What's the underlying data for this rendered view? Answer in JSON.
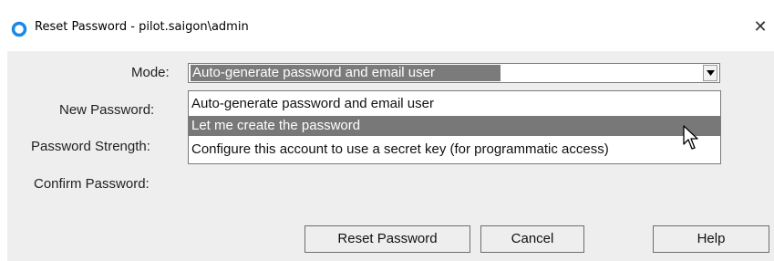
{
  "window": {
    "title": "Reset Password - pilot.saigon\\admin",
    "close_glyph": "✕"
  },
  "form": {
    "mode_label": "Mode:",
    "new_password_label": "New Password:",
    "password_strength_label": "Password Strength:",
    "confirm_password_label": "Confirm Password:"
  },
  "mode_select": {
    "selected_value": "Auto-generate password and email user",
    "options": [
      "Auto-generate password and email user",
      "Let me create the password",
      "Configure this account to use a secret key (for programmatic access)"
    ],
    "highlighted_index": 1
  },
  "buttons": {
    "reset_password": "Reset Password",
    "cancel": "Cancel",
    "help": "Help"
  },
  "colors": {
    "accent_icon": "#1e88e5",
    "selection_bg": "#787878",
    "panel_bg": "#eeeeee"
  },
  "icons": {
    "app": "circle-ring-icon",
    "close": "close-icon",
    "dropdown": "chevron-down-icon",
    "pointer": "mouse-cursor-icon"
  }
}
